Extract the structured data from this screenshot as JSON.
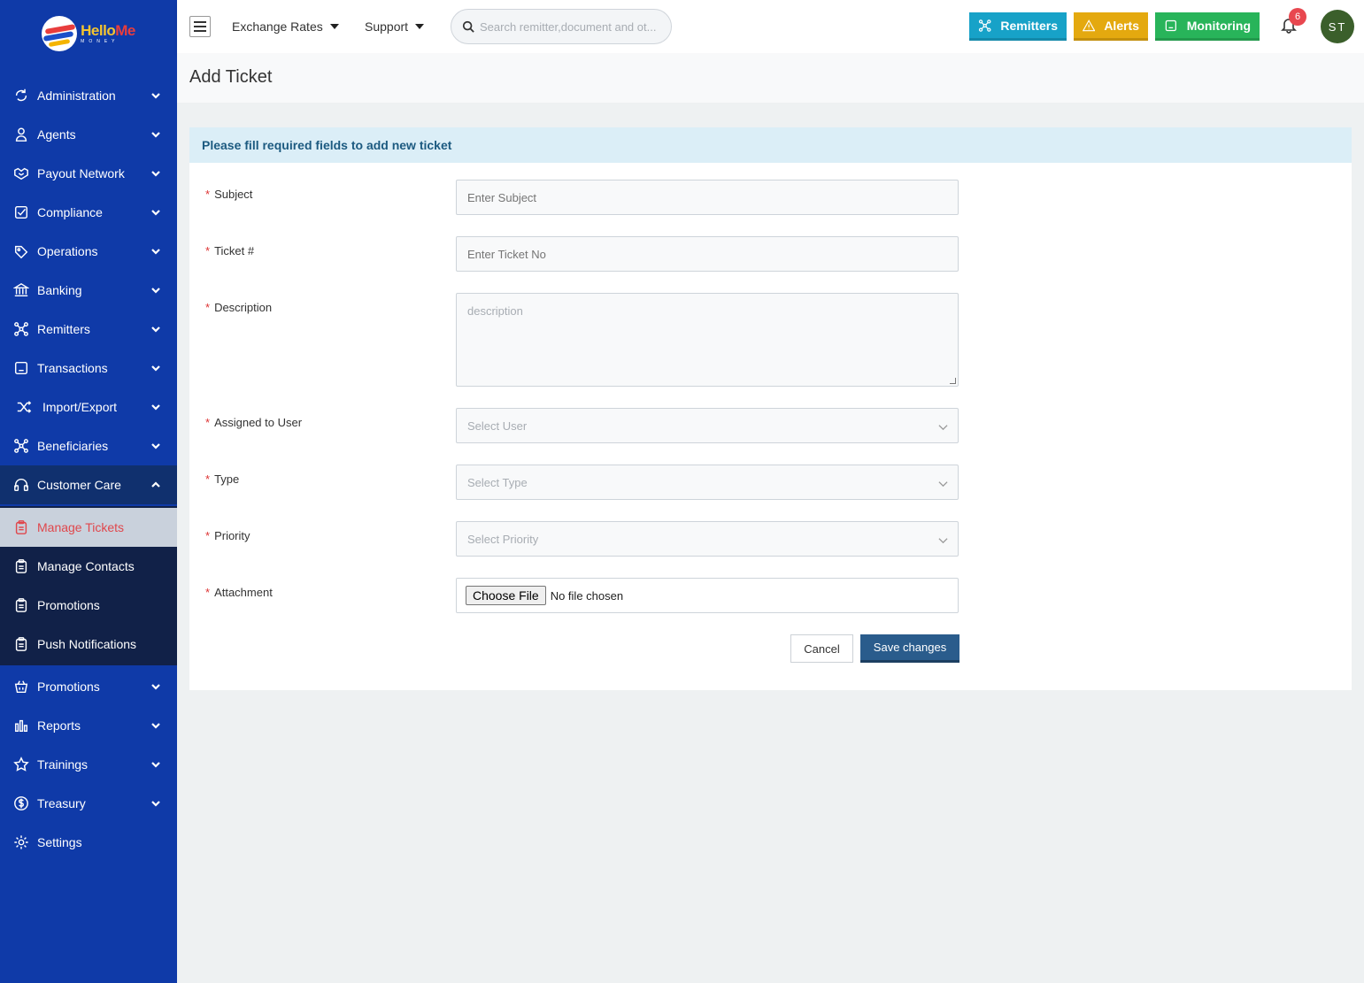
{
  "brand": {
    "name_part1": "Hello",
    "name_part2": "Me",
    "sub": "MONEY"
  },
  "sidebar": {
    "items": [
      {
        "label": "Administration",
        "icon": "refresh-icon"
      },
      {
        "label": "Agents",
        "icon": "user-icon"
      },
      {
        "label": "Payout Network",
        "icon": "handshake-icon"
      },
      {
        "label": "Compliance",
        "icon": "checkbox-icon"
      },
      {
        "label": "Operations",
        "icon": "tag-icon"
      },
      {
        "label": "Banking",
        "icon": "bank-icon"
      },
      {
        "label": "Remitters",
        "icon": "network-icon"
      },
      {
        "label": "Transactions",
        "icon": "receipt-icon"
      },
      {
        "label": "Import/Export",
        "icon": "shuffle-icon"
      },
      {
        "label": "Beneficiaries",
        "icon": "network-icon"
      },
      {
        "label": "Customer Care",
        "icon": "headset-icon"
      },
      {
        "label": "Manage Tickets",
        "icon": "clipboard-icon"
      },
      {
        "label": "Manage Contacts",
        "icon": "clipboard-icon"
      },
      {
        "label": "Promotions",
        "icon": "clipboard-icon"
      },
      {
        "label": "Push Notifications",
        "icon": "clipboard-icon"
      },
      {
        "label": "Promotions",
        "icon": "basket-icon"
      },
      {
        "label": "Reports",
        "icon": "bar-chart-icon"
      },
      {
        "label": "Trainings",
        "icon": "star-icon"
      },
      {
        "label": "Treasury",
        "icon": "dollar-icon"
      },
      {
        "label": "Settings",
        "icon": "gear-icon"
      }
    ]
  },
  "topbar": {
    "menu1": "Exchange Rates",
    "menu2": "Support",
    "search_placeholder": "Search remitter,document and ot...",
    "remitters_label": "Remitters",
    "alerts_label": "Alerts",
    "monitoring_label": "Monitoring",
    "notification_count": "6",
    "avatar_initials": "ST",
    "colors": {
      "remitters": "#17a2c8",
      "alerts": "#e4a90f",
      "monitoring": "#28b45a"
    }
  },
  "page": {
    "title": "Add Ticket"
  },
  "form": {
    "header": "Please fill required fields to add new ticket",
    "subject_label": "Subject",
    "subject_placeholder": "Enter Subject",
    "ticket_label": "Ticket #",
    "ticket_placeholder": "Enter Ticket No",
    "description_label": "Description",
    "description_placeholder": "description",
    "assigned_label": "Assigned to User",
    "assigned_placeholder": "Select User",
    "type_label": "Type",
    "type_placeholder": "Select Type",
    "priority_label": "Priority",
    "priority_placeholder": "Select Priority",
    "attachment_label": "Attachment",
    "choose_file": "Choose File",
    "no_file": "No file chosen",
    "required_mark": "*",
    "cancel": "Cancel",
    "save": "Save changes"
  }
}
